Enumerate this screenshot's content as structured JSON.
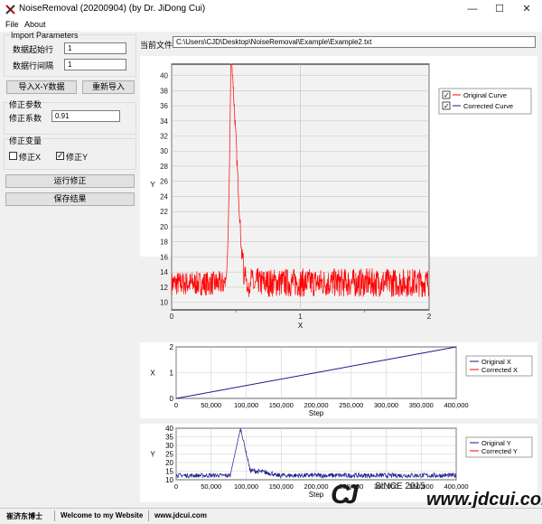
{
  "window": {
    "title": "NoiseRemoval (20200904) (by Dr. JiDong Cui)",
    "minimize_glyph": "—",
    "maximize_glyph": "☐",
    "close_glyph": "✕"
  },
  "menu": [
    "File",
    "About"
  ],
  "import": {
    "group_label": "Import Parameters",
    "start_row_label": "数据起始行",
    "start_row_value": "1",
    "interval_label": "数据行间隔",
    "interval_value": "1",
    "import_xy_button": "导入X-Y数据",
    "reimport_button": "重新导入"
  },
  "correction": {
    "params_label": "修正参数",
    "coef_label": "修正系数",
    "coef_value": "0.91",
    "vars_label": "修正变量",
    "fix_x_label": "修正X",
    "fix_x_checked": false,
    "fix_y_label": "修正Y",
    "fix_y_checked": true,
    "run_button": "运行修正",
    "save_button": "保存结果"
  },
  "file": {
    "label": "当前文件",
    "path": "C:\\Users\\CJD\\Desktop\\NoiseRemoval\\Example\\Example2.txt"
  },
  "colors": {
    "original": "#1a1a8c",
    "corrected": "#ff0000",
    "main_bg": "#f2f2f2"
  },
  "main_legend": [
    {
      "label": "Original Curve",
      "checked": true
    },
    {
      "label": "Corrected Curve",
      "checked": true
    }
  ],
  "chart_data": [
    {
      "type": "line",
      "xlabel": "X",
      "ylabel": "Y",
      "xlim": [
        0,
        2
      ],
      "ylim": [
        9,
        41.5
      ],
      "xticks": [
        "0",
        "1",
        "2"
      ],
      "yticks": [
        "10",
        "12",
        "14",
        "16",
        "18",
        "20",
        "22",
        "24",
        "26",
        "28",
        "30",
        "32",
        "34",
        "36",
        "38",
        "40"
      ],
      "series": [
        {
          "name": "Original Curve",
          "color": "#1a1a8c",
          "visible_note": "hidden under corrected"
        },
        {
          "name": "Corrected Curve",
          "color": "#ff0000",
          "baseline_before": 12.5,
          "noise_before": 1.6,
          "peak_x": 0.46,
          "peak_y": 41.5,
          "baseline_after": 12.6,
          "noise_after": 1.9
        }
      ]
    },
    {
      "type": "line",
      "xlabel": "Step",
      "ylabel": "X",
      "xlim": [
        0,
        400000
      ],
      "ylim": [
        0,
        2
      ],
      "xticks": [
        "0",
        "50,000",
        "100,000",
        "150,000",
        "200,000",
        "250,000",
        "300,000",
        "350,000",
        "400,000"
      ],
      "yticks": [
        "0",
        "1",
        "2"
      ],
      "yticks_labels": [
        "0",
        "1",
        "2"
      ],
      "series": [
        {
          "name": "Original X",
          "x": [
            0,
            400000
          ],
          "y": [
            0,
            2
          ]
        },
        {
          "name": "Corrected X",
          "x": [
            0,
            400000
          ],
          "y": [
            0,
            2
          ]
        }
      ]
    },
    {
      "type": "line",
      "xlabel": "Step",
      "ylabel": "Y",
      "xlim": [
        0,
        400000
      ],
      "ylim": [
        10,
        40
      ],
      "xticks": [
        "0",
        "50,000",
        "100,000",
        "150,000",
        "200,000",
        "250,000",
        "300,000",
        "350,000",
        "400,000"
      ],
      "yticks": [
        "10",
        "15",
        "20",
        "25",
        "30",
        "35",
        "40"
      ],
      "series": [
        {
          "name": "Original Y",
          "peak_step": 92000,
          "peak_y": 40,
          "baseline": 12.5
        },
        {
          "name": "Corrected Y"
        }
      ]
    }
  ],
  "chart1_y_extra": [
    "0.5",
    "1.5"
  ],
  "status": {
    "author": "崔济东博士",
    "welcome": "Welcome to my Website",
    "site": "www.jdcui.com"
  },
  "watermark": {
    "since": "SINCE 2015",
    "url": "www.jdcui.com"
  }
}
